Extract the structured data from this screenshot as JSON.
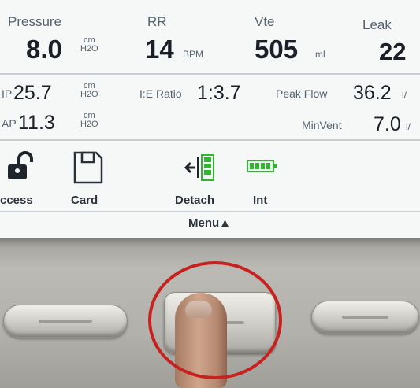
{
  "top_row": {
    "pressure_label": "Pressure",
    "pressure_value": "8.0",
    "pressure_unit_top": "cm",
    "pressure_unit_bottom": "H2O",
    "rr_label": "RR",
    "rr_value": "14",
    "rr_unit": "BPM",
    "vte_label": "Vte",
    "vte_value": "505",
    "vte_unit": "ml",
    "leak_label": "Leak",
    "leak_value": "22"
  },
  "second_row": {
    "pip_label": "IP",
    "pip_value": "25.7",
    "pip_unit_top": "cm",
    "pip_unit_bottom": "H2O",
    "ie_label": "I:E Ratio",
    "ie_value": "1:3.7",
    "peakflow_label": "Peak Flow",
    "peakflow_value": "36.2",
    "peakflow_unit": "l/",
    "map_label": "AP",
    "map_value": "11.3",
    "map_unit_top": "cm",
    "map_unit_bottom": "H2O",
    "minvent_label": "MinVent",
    "minvent_value": "7.0",
    "minvent_unit": "l/"
  },
  "icons": {
    "access_label": "ccess",
    "card_label": "Card",
    "detach_label": "Detach",
    "int_label": "Int"
  },
  "menu": {
    "label": "Menu▲"
  },
  "colors": {
    "screen_bg": "#f6f7f7",
    "battery_green": "#2fb52f",
    "circle_red": "#c7221f"
  }
}
